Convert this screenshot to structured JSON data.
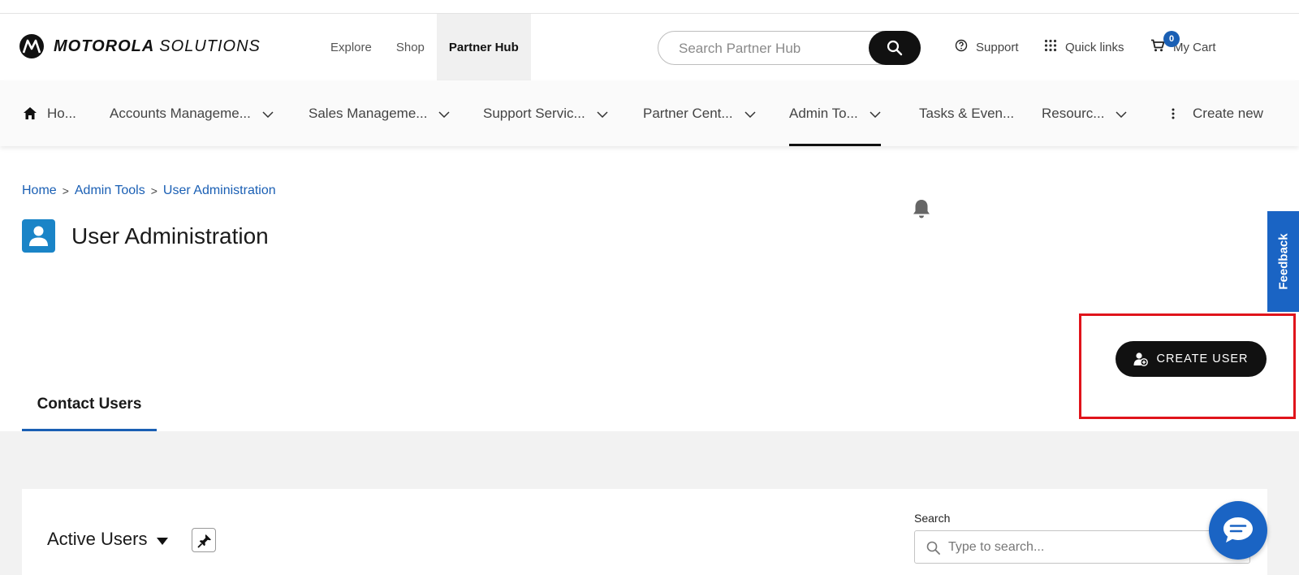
{
  "brand": {
    "name_bold": "MOTOROLA",
    "name_light": "SOLUTIONS"
  },
  "top_nav": [
    "Explore",
    "Shop",
    "Partner Hub"
  ],
  "search": {
    "placeholder": "Search Partner Hub"
  },
  "utilities": {
    "support": "Support",
    "quick_links": "Quick links",
    "cart": "My Cart",
    "cart_count": "0"
  },
  "secondary_nav": {
    "home": "Ho...",
    "accounts": "Accounts Manageme...",
    "sales": "Sales Manageme...",
    "support": "Support Servic...",
    "partner": "Partner Cent...",
    "admin": "Admin To...",
    "tasks": "Tasks & Even...",
    "resources": "Resourc...",
    "create_new": "Create new"
  },
  "breadcrumb": [
    "Home",
    "Admin Tools",
    "User Administration"
  ],
  "breadcrumb_sep": ">",
  "page": {
    "title": "User Administration"
  },
  "feedback": "Feedback",
  "create_user": "CREATE USER",
  "tab": "Contact Users",
  "list": {
    "title": "Active Users",
    "search_label": "Search",
    "search_placeholder": "Type to search..."
  },
  "colors": {
    "accent_blue": "#1a5fb4",
    "highlight_red": "#e0141b",
    "icon_tile": "#1a84c7"
  }
}
